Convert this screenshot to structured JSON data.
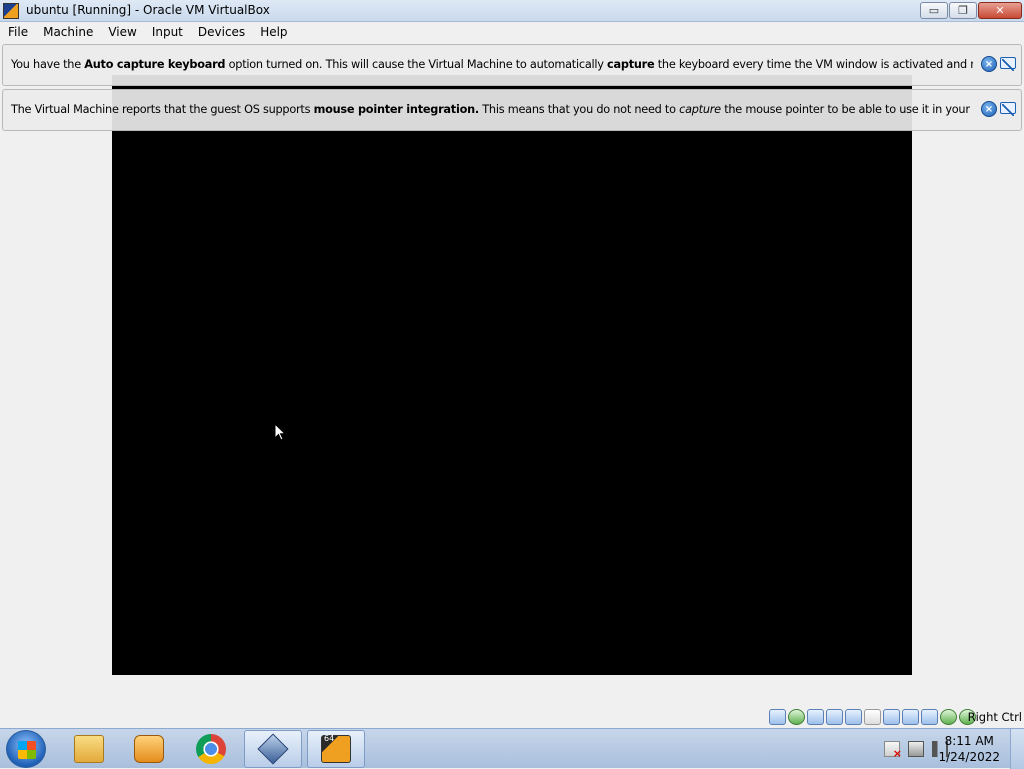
{
  "window": {
    "title": "ubuntu [Running] - Oracle VM VirtualBox",
    "minimize_glyph": "▭",
    "restore_glyph": "❐",
    "close_glyph": "✕"
  },
  "menu": [
    "File",
    "Machine",
    "View",
    "Input",
    "Devices",
    "Help"
  ],
  "notifications": [
    {
      "parts": [
        {
          "text": "You have the ",
          "style": "normal"
        },
        {
          "text": "Auto capture keyboard",
          "style": "bold"
        },
        {
          "text": " option turned on. This will cause the Virtual Machine to automatically ",
          "style": "normal"
        },
        {
          "text": "capture",
          "style": "bold"
        },
        {
          "text": " the keyboard every time the VM window is activated and make it unavailable to",
          "style": "normal"
        }
      ]
    },
    {
      "parts": [
        {
          "text": "The Virtual Machine reports that the guest OS supports ",
          "style": "normal"
        },
        {
          "text": "mouse pointer integration.",
          "style": "bold"
        },
        {
          "text": " This means that you do not need to ",
          "style": "normal"
        },
        {
          "text": "capture",
          "style": "italic"
        },
        {
          "text": " the mouse pointer to be able to use it in your guest OS -- all mouse",
          "style": "normal"
        }
      ]
    }
  ],
  "notice_icons": {
    "close": "close-icon",
    "dont_show": "speech-bubble-icon",
    "close_glyph": "×"
  },
  "statusbar": {
    "icons": [
      "hard-disk-icon",
      "optical-drive-icon",
      "audio-icon",
      "network-icon",
      "usb-icon",
      "shared-folders-icon",
      "display-icon",
      "video-capture-icon",
      "virtualization-icon",
      "cpu-icon",
      "mouse-integration-icon",
      "keyboard-icon"
    ],
    "host_key": "Right Ctrl"
  },
  "taskbar": {
    "apps": [
      "windows-explorer",
      "media-player",
      "chrome",
      "virtualbox",
      "virtualbox-vm"
    ],
    "vm_badge": "64",
    "clock_time": "8:11 AM",
    "clock_date": "1/24/2022"
  }
}
